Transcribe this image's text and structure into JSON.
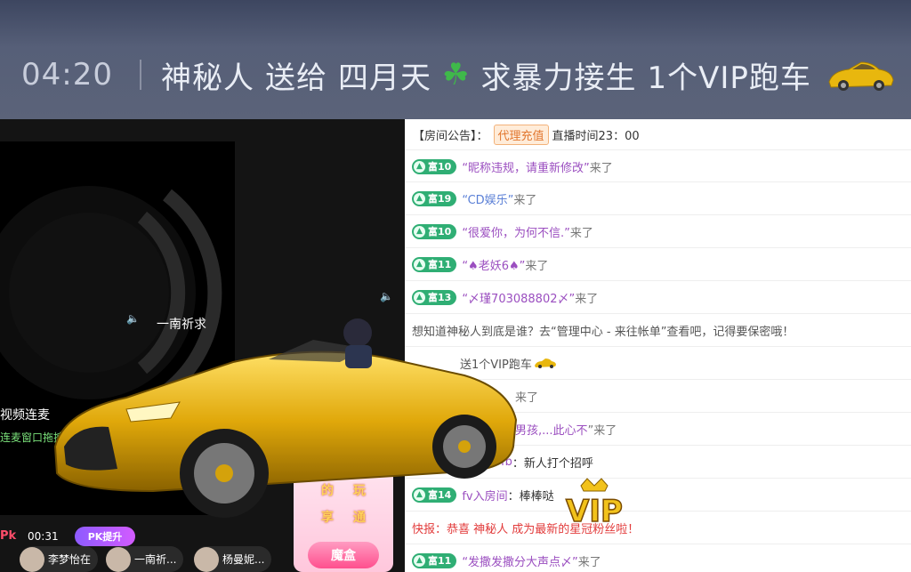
{
  "banner": {
    "time": "04:20",
    "sender": "神秘人",
    "verb": "送给",
    "receiver": "四月天",
    "receiver_suffix": "求暴力接生",
    "gift": "1个VIP跑车"
  },
  "video": {
    "anchor_name": "一南祈求",
    "link_title": "视频连麦",
    "link_tip": "连麦窗口拖拽",
    "pk_logo": "Pk",
    "pk_time": "00:31",
    "pk_badge": "PK提升",
    "users": [
      "李梦怡在",
      "一南祈...",
      "杨曼妮..."
    ]
  },
  "gift_box": {
    "cells": [
      "的",
      "玩",
      "享",
      "通"
    ],
    "button": "魔盒"
  },
  "chat": {
    "notice_label": "【房间公告】：",
    "notice_tag": "代理充值",
    "notice_text": "直播时间23：00",
    "rows": [
      {
        "level": "富10",
        "name": "“昵称违规，请重新修改”",
        "suffix": "来了"
      },
      {
        "level": "富19",
        "name": "“CD娱乐”",
        "suffix": "来了"
      },
      {
        "level": "富10",
        "name": "“很爱你，为何不信.”",
        "suffix": "来了"
      },
      {
        "level": "富11",
        "name": "“♠老妖6♠”",
        "suffix": "来了"
      },
      {
        "level": "富13",
        "name": "“〆瑾703088802〆”",
        "suffix": "来了"
      },
      {
        "text": "想知道神秘人到底是谁？去“管理中心 - 来往帐单”查看吧，记得要保密哦！"
      },
      {
        "text": "送1个VIP跑车"
      },
      {
        "text": "来了"
      },
      {
        "name": "男孩,...此心不",
        "suffix": "”来了"
      },
      {
        "name": "fb",
        "suffix": "：新人打个招呼"
      },
      {
        "level": "富14",
        "name": "fv入房间",
        "suffix": "：棒棒哒"
      },
      {
        "text": "快报：恭喜 神秘人 成为最新的星冠粉丝啦！"
      },
      {
        "level": "富11",
        "name": "“发撒发撒分大声点〆”",
        "suffix": "来了"
      }
    ]
  },
  "colors": {
    "level_badge": "#2fae74",
    "nickname": "#9b4fc0",
    "news": "#e23b3b",
    "gold": "#f2c21b"
  },
  "icons": [
    "clover-icon",
    "sports-car-icon",
    "speaker-icon",
    "avatar-icon",
    "vip-crown-icon"
  ]
}
